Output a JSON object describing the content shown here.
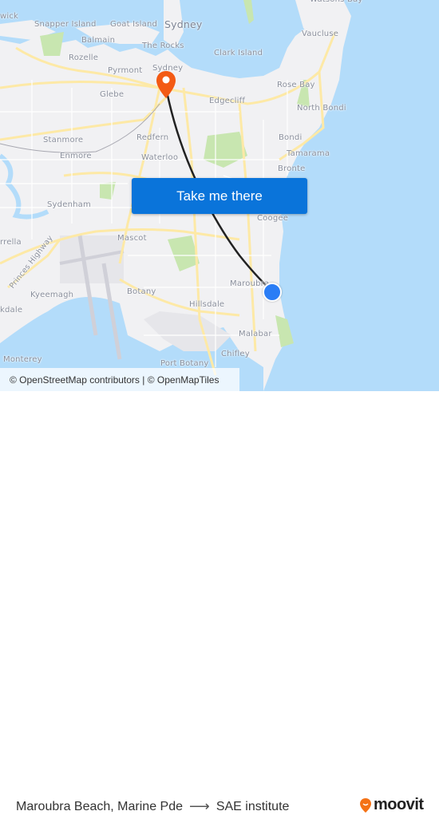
{
  "map": {
    "labels": {
      "warwick": "wick",
      "snapper_island": "Snapper Island",
      "goat_island": "Goat Island",
      "sydney_big": "Sydney",
      "balmain": "Balmain",
      "the_rocks": "The Rocks",
      "rozelle": "Rozelle",
      "pyrmont": "Pyrmont",
      "sydney": "Sydney",
      "glebe": "Glebe",
      "clark_island": "Clark Island",
      "vaucluse": "Vaucluse",
      "watsons_bay": "Watsons Bay",
      "rose_bay": "Rose Bay",
      "edgecliff": "Edgecliff",
      "north_bondi": "North Bondi",
      "bondi": "Bondi",
      "tamarama": "Tamarama",
      "bronte": "Bronte",
      "stanmore": "Stanmore",
      "redfern": "Redfern",
      "enmore": "Enmore",
      "waterloo": "Waterloo",
      "sydenham": "Sydenham",
      "coogee": "Coogee",
      "arrella": "rrella",
      "mascot": "Mascot",
      "princes_highway": "Princes Highway",
      "kyeemagh": "Kyeemagh",
      "botany": "Botany",
      "kdale": "kdale",
      "hillsdale": "Hillsdale",
      "maroubra": "Maroubra",
      "malabar": "Malabar",
      "monterey": "Monterey",
      "chifley": "Chifley",
      "port_botany": "Port Botany"
    },
    "origin_marker": "origin-dot",
    "destination_marker": "destination-pin",
    "cta_label": "Take me there",
    "attribution": {
      "osm": "© OpenStreetMap contributors",
      "sep": " | ",
      "omt": "© OpenMapTiles"
    }
  },
  "footer": {
    "origin": "Maroubra Beach, Marine Pde",
    "arrow": "⟶",
    "destination": "SAE institute",
    "brand": "moovit"
  },
  "colors": {
    "water": "#b3dcfa",
    "land": "#f1f1f3",
    "road_major": "#fde9a6",
    "park": "#c8e6b0",
    "route": "#222222",
    "cta": "#0a74da",
    "origin": "#2a7df5",
    "destination": "#f35a14",
    "brand": "#f47216"
  }
}
